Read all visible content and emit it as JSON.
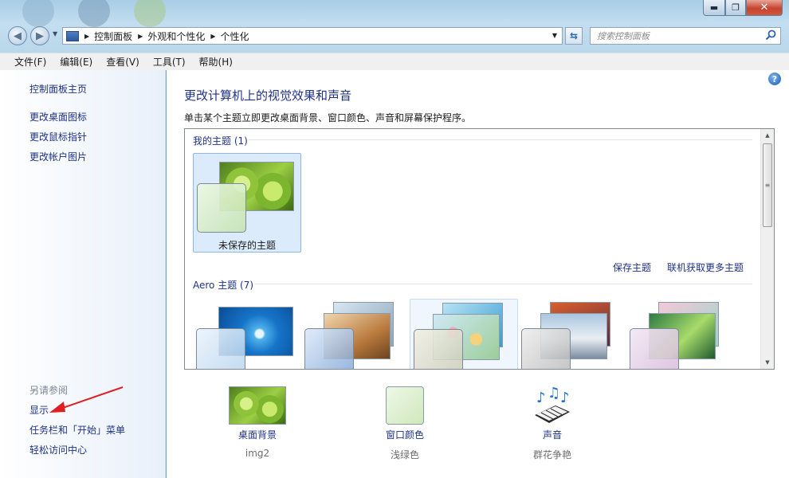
{
  "window": {
    "buttons": {
      "minimize": "▬",
      "maximize": "❐",
      "close": "✕"
    }
  },
  "nav": {
    "breadcrumbs": [
      "控制面板",
      "外观和个性化",
      "个性化"
    ],
    "search_placeholder": "搜索控制面板"
  },
  "menubar": {
    "items": [
      "文件(F)",
      "编辑(E)",
      "查看(V)",
      "工具(T)",
      "帮助(H)"
    ]
  },
  "sidebar": {
    "home": "控制面板主页",
    "links": [
      "更改桌面图标",
      "更改鼠标指针",
      "更改帐户图片"
    ],
    "see_also_title": "另请参阅",
    "see_also": [
      "显示",
      "任务栏和「开始」菜单",
      "轻松访问中心"
    ]
  },
  "main": {
    "title": "更改计算机上的视觉效果和声音",
    "description": "单击某个主题立即更改桌面背景、窗口颜色、声音和屏幕保护程序。",
    "help": "?",
    "my_themes": {
      "header": "我的主题 (1)",
      "items": [
        {
          "label": "未保存的主题"
        }
      ],
      "save_link": "保存主题",
      "online_link": "联机获取更多主题"
    },
    "aero_themes": {
      "header": "Aero 主题 (7)"
    }
  },
  "bottom": {
    "desktop_background": {
      "label": "桌面背景",
      "value": "img2"
    },
    "window_color": {
      "label": "窗口颜色",
      "value": "浅绿色"
    },
    "sounds": {
      "label": "声音",
      "value": "群花争艳"
    }
  },
  "colors": {
    "link": "#1e3287",
    "selected_tile": "#dcebfc",
    "annotation_arrow": "#e02020"
  },
  "icons": [
    "back-icon",
    "forward-icon",
    "control-panel-icon",
    "refresh-icon",
    "search-icon",
    "help-icon",
    "music-keyboard-icon"
  ]
}
